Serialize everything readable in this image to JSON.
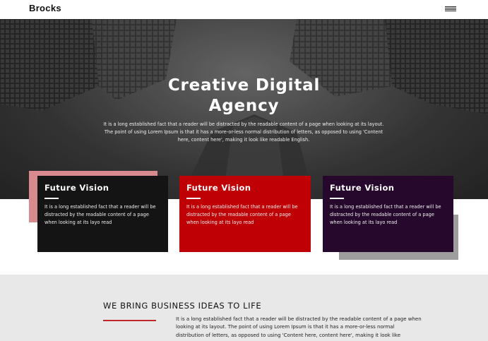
{
  "nav": {
    "brand": "Brocks",
    "menu_icon": "hamburger-menu-icon"
  },
  "hero": {
    "title_line1": "Creative Digital",
    "title_line2": "Agency",
    "description": "It is a long established fact that a reader will be distracted by the readable content of a page when looking at its layout. The point of using Lorem Ipsum is that it has a more-or-less normal distribution of letters, as opposed to using 'Content here, content here', making it look like readable English."
  },
  "cards": [
    {
      "title": "Future Vision",
      "text": "It is a long established fact that a reader will be distracted by the readable content of a page when looking at its layo read",
      "color": "#141414"
    },
    {
      "title": "Future Vision",
      "text": "It is a long established fact that a reader will be distracted by the readable content of a page when looking at its layo read",
      "color": "#bf0005"
    },
    {
      "title": "Future Vision",
      "text": "It is a long established fact that a reader will be distracted by the readable content of a page when looking at its layo read",
      "color": "#27082d"
    }
  ],
  "about": {
    "title": "WE BRING BUSINESS IDEAS TO LIFE",
    "text": "It is a long established fact that a reader will be distracted by the readable content of a page when looking at its layout. The point of using Lorem Ipsum is that it has a more-or-less normal distribution of letters, as opposed to using 'Content here, content here', making it look like",
    "accent": "#c0272d"
  }
}
